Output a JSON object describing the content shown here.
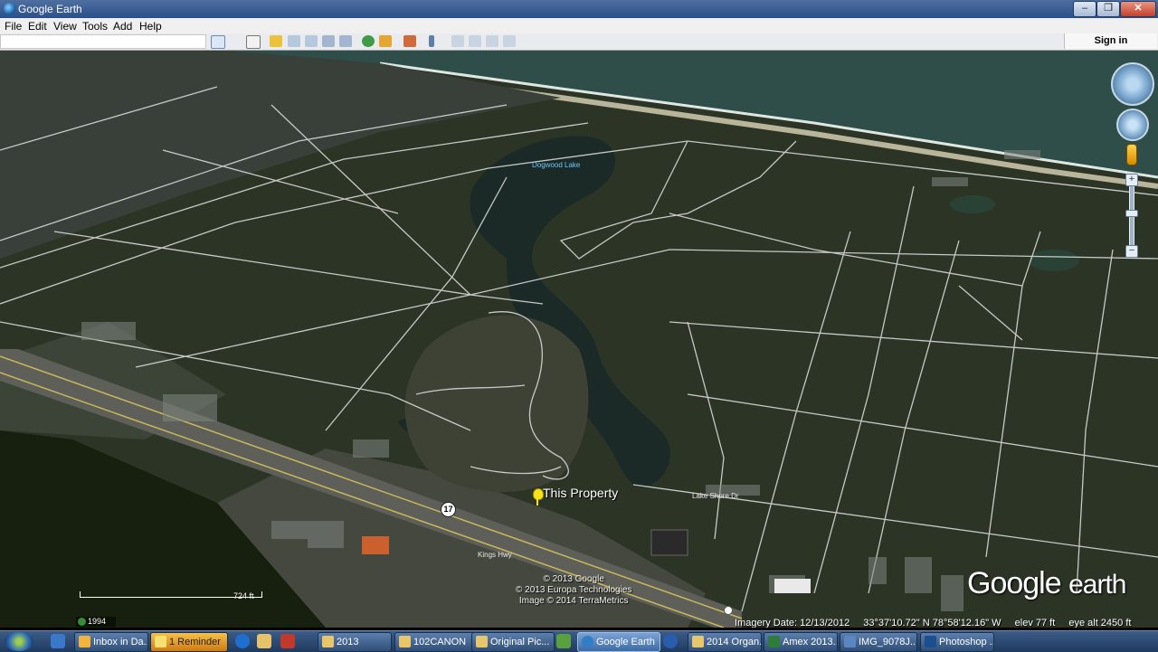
{
  "window": {
    "title": "Google Earth",
    "min": "–",
    "max": "❐",
    "close": "✕"
  },
  "menu": [
    "File",
    "Edit",
    "View",
    "Tools",
    "Add",
    "Help"
  ],
  "toolbar": {
    "signin": "Sign in"
  },
  "map": {
    "lake_label": "Dogwood Lake",
    "property_label": "This Property",
    "route_badge": "17",
    "road_labels": [
      "Lake Shore Dr",
      "Kings Hwy"
    ],
    "copyright": [
      "© 2013 Google",
      "© 2013 Europa Technologies",
      "Image © 2014 TerraMetrics"
    ],
    "logo_google": "Google",
    "logo_earth": "earth",
    "scale_label": "724 ft",
    "history_year": "1994",
    "status": {
      "imagery_date": "Imagery Date: 12/13/2012",
      "coords": "33°37'10.72\" N  78°58'12.16\" W",
      "elev": "elev   77 ft",
      "eye_alt": "eye alt  2450 ft"
    },
    "colors": {
      "water": "#1b2a26",
      "ocean": "#2f4e4a",
      "vegetation": "#2a3420",
      "roads": "#d9d9d9",
      "pin": "#f7e21a"
    }
  },
  "taskbar": {
    "tasks": [
      {
        "label": "Inbox in Da..."
      },
      {
        "label": "1 Reminder"
      },
      {
        "label": "2013"
      },
      {
        "label": "102CANON"
      },
      {
        "label": "Original Pic..."
      },
      {
        "label": "Google Earth"
      },
      {
        "label": "2014 Organ..."
      },
      {
        "label": "Amex 2013..."
      },
      {
        "label": "IMG_9078J..."
      },
      {
        "label": "Photoshop ..."
      }
    ]
  }
}
